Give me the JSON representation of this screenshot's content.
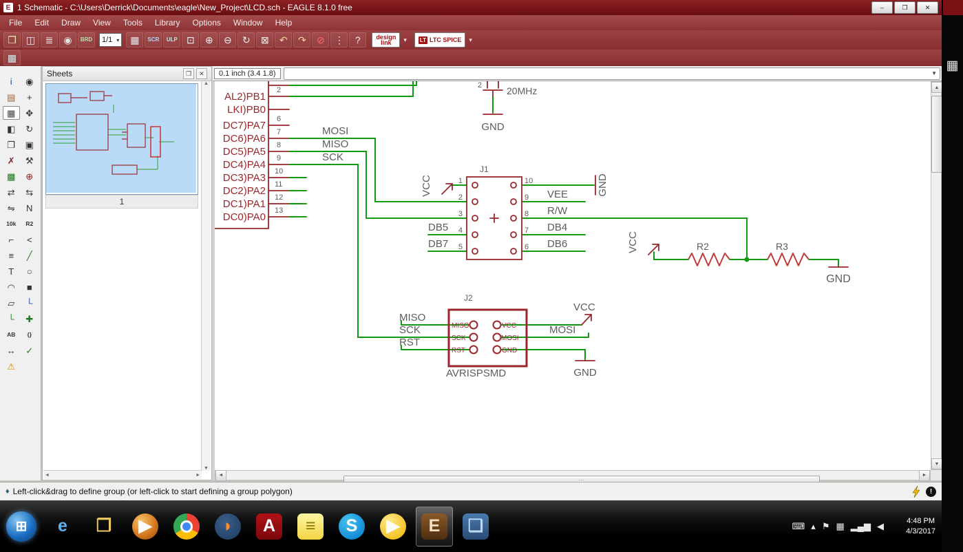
{
  "window": {
    "icon": "E",
    "title": "1 Schematic - C:\\Users\\Derrick\\Documents\\eagle\\New_Project\\LCD.sch - EAGLE 8.1.0 free",
    "minimize": "–",
    "maximize": "❐",
    "close": "✕"
  },
  "menubar": [
    {
      "n": "menu-file",
      "label": "File"
    },
    {
      "n": "menu-edit",
      "label": "Edit"
    },
    {
      "n": "menu-draw",
      "label": "Draw"
    },
    {
      "n": "menu-view",
      "label": "View"
    },
    {
      "n": "menu-tools",
      "label": "Tools"
    },
    {
      "n": "menu-library",
      "label": "Library"
    },
    {
      "n": "menu-options",
      "label": "Options"
    },
    {
      "n": "menu-window",
      "label": "Window"
    },
    {
      "n": "menu-help",
      "label": "Help"
    }
  ],
  "toolbar": {
    "icons1": [
      {
        "n": "open-button",
        "g": "❒",
        "c": "#f7e9b5"
      },
      {
        "n": "save-button",
        "g": "◫",
        "c": "#e8e8f7"
      },
      {
        "n": "print-button",
        "g": "≣",
        "c": "#f0f0f0"
      },
      {
        "n": "export-image-button",
        "g": "◉",
        "c": "#e2e2e2"
      },
      {
        "n": "switch-to-board-button",
        "g": "BRD",
        "c": "#a5e8a5"
      }
    ],
    "sheet_combo": "1/1",
    "caret": "▾",
    "icons2": [
      {
        "n": "grid-table-button",
        "g": "▦",
        "c": "#e8e8e8"
      },
      {
        "n": "run-script-button",
        "g": "SCR",
        "c": "#bcd4f5"
      },
      {
        "n": "run-ulp-button",
        "g": "ULP",
        "c": "#bfe8e0"
      },
      {
        "n": "zoom-fit-button",
        "g": "⊡",
        "c": "#f0f0f0"
      },
      {
        "n": "zoom-in-button",
        "g": "⊕",
        "c": "#f0f0f0"
      },
      {
        "n": "zoom-out-button",
        "g": "⊖",
        "c": "#f0f0f0"
      },
      {
        "n": "zoom-redraw-button",
        "g": "↻",
        "c": "#f0f0f0"
      },
      {
        "n": "zoom-select-button",
        "g": "⊠",
        "c": "#f0f0f0"
      },
      {
        "n": "undo-button",
        "g": "↶",
        "c": "#f7d9a0"
      },
      {
        "n": "redo-button",
        "g": "↷",
        "c": "#f7d9a0"
      },
      {
        "n": "stop-button",
        "g": "⊘",
        "c": "#ff6a6a"
      },
      {
        "n": "overflow-button",
        "g": "⋮",
        "c": "#f0f0f0"
      },
      {
        "n": "help-button",
        "g": "?",
        "c": "#f0f0f0"
      }
    ],
    "design_link": {
      "top": "design",
      "bottom": "link"
    },
    "ltc_logo": "LT",
    "ltc_label": "LTC SPICE",
    "grid_button": "▦"
  },
  "coordbar": {
    "coords": "0.1 inch (3.4 1.8)",
    "dropdown_icon": "▼"
  },
  "sheets": {
    "title": "Sheets",
    "dock_icon": "❐",
    "close_icon": "✕",
    "sheet_label": "1"
  },
  "tools": [
    {
      "n": "tool-info-icon",
      "g": "i",
      "c": "#20508e"
    },
    {
      "n": "tool-show-icon",
      "g": "◉",
      "c": "#333333"
    },
    {
      "n": "tool-display-icon",
      "g": "▤",
      "c": "#a06030"
    },
    {
      "n": "tool-mark-icon",
      "g": "+",
      "c": "#333333"
    },
    {
      "n": "tool-group-icon",
      "g": "▦",
      "c": "#444444",
      "sel": true
    },
    {
      "n": "tool-move-icon",
      "g": "✥",
      "c": "#333333"
    },
    {
      "n": "tool-mirror-icon",
      "g": "◧",
      "c": "#333333"
    },
    {
      "n": "tool-rotate-icon",
      "g": "↻",
      "c": "#333333"
    },
    {
      "n": "tool-copy-icon",
      "g": "❐",
      "c": "#333333"
    },
    {
      "n": "tool-paste-icon",
      "g": "▣",
      "c": "#333333"
    },
    {
      "n": "tool-delete-icon",
      "g": "✗",
      "c": "#8a1f1f"
    },
    {
      "n": "tool-fix-icon",
      "g": "⚒",
      "c": "#333333"
    },
    {
      "n": "tool-change-icon",
      "g": "▩",
      "c": "#1f7a1f"
    },
    {
      "n": "tool-add-icon",
      "g": "⊕",
      "c": "#8a1f1f"
    },
    {
      "n": "tool-pinswap-icon",
      "g": "⇄",
      "c": "#333333"
    },
    {
      "n": "tool-replace-icon",
      "g": "⇆",
      "c": "#333333"
    },
    {
      "n": "tool-gateswap-icon",
      "g": "⇋",
      "c": "#333333"
    },
    {
      "n": "tool-name-icon",
      "g": "N",
      "c": "#333333"
    },
    {
      "n": "tool-value-icon",
      "g": "10k",
      "c": "#333333"
    },
    {
      "n": "tool-smash-icon",
      "g": "R2",
      "c": "#333333"
    },
    {
      "n": "tool-miter-icon",
      "g": "⌐",
      "c": "#333333"
    },
    {
      "n": "tool-split-icon",
      "g": "<",
      "c": "#333333"
    },
    {
      "n": "tool-invoke-icon",
      "g": "≡",
      "c": "#333333"
    },
    {
      "n": "tool-wire-icon",
      "g": "╱",
      "c": "#1f7a1f"
    },
    {
      "n": "tool-text-icon",
      "g": "T",
      "c": "#333333"
    },
    {
      "n": "tool-circle-icon",
      "g": "○",
      "c": "#333333"
    },
    {
      "n": "tool-arc-icon",
      "g": "◠",
      "c": "#333333"
    },
    {
      "n": "tool-rect-icon",
      "g": "■",
      "c": "#333333"
    },
    {
      "n": "tool-polygon-icon",
      "g": "▱",
      "c": "#333333"
    },
    {
      "n": "tool-bus-icon",
      "g": "└",
      "c": "#2244aa"
    },
    {
      "n": "tool-net-icon",
      "g": "└",
      "c": "#1f7a1f"
    },
    {
      "n": "tool-junction-icon",
      "g": "✚",
      "c": "#1f7a1f"
    },
    {
      "n": "tool-label-icon",
      "g": "AB",
      "c": "#333333"
    },
    {
      "n": "tool-attribute-icon",
      "g": "{}",
      "c": "#333333"
    },
    {
      "n": "tool-dimension-icon",
      "g": "↔",
      "c": "#333333"
    },
    {
      "n": "tool-erc-icon",
      "g": "✓",
      "c": "#1f7a1f"
    },
    {
      "n": "tool-errors-icon",
      "g": "⚠",
      "c": "#d89000"
    }
  ],
  "schematic": {
    "colors": {
      "wire": "#129a12",
      "symbol": "#9b262b",
      "label": "#5c5c5c",
      "resistor": "#c23b3b"
    },
    "ic": {
      "pins": [
        "AL2)PB1",
        "LKI)PB0",
        "DC7)PA7",
        "DC6)PA6",
        "DC5)PA5",
        "DC4)PA4",
        "DC3)PA3",
        "DC2)PA2",
        "DC1)PA1",
        "DC0)PA0"
      ],
      "numbers": [
        "2",
        "6",
        "7",
        "8",
        "9",
        "10",
        "11",
        "12",
        "13"
      ]
    },
    "nets": {
      "mosi": "MOSI",
      "miso": "MISO",
      "sck": "SCK"
    },
    "crystal": {
      "pin": "2",
      "value": "20MHz",
      "gnd": "GND"
    },
    "j1": {
      "name": "J1",
      "left_numbers": [
        "1",
        "2",
        "3",
        "4",
        "5"
      ],
      "right_numbers": [
        "10",
        "9",
        "8",
        "7",
        "6"
      ],
      "vcc": "VCC",
      "gnd": "GND",
      "vee": "VEE",
      "rw": "R/W",
      "db4": "DB4",
      "db5": "DB5",
      "db6": "DB6",
      "db7": "DB7"
    },
    "divider": {
      "vcc": "VCC",
      "r2": "R2",
      "r3": "R3",
      "gnd": "GND"
    },
    "j2": {
      "name": "J2",
      "value": "AVRISPSMD",
      "inner": [
        "MISO",
        "VCC",
        "SCK",
        "MOSI",
        "RST",
        "GND"
      ],
      "left": [
        "MISO",
        "SCK",
        "RST"
      ],
      "vcc": "VCC",
      "mosi": "MOSI",
      "gnd": "GND"
    }
  },
  "scrollbar": {
    "up": "▲",
    "down": "▼",
    "left": "◄",
    "right": "►",
    "grip": "⋯"
  },
  "statusbar": {
    "bullet": "♦",
    "message": "Left-click&drag to define group (or left-click to start defining a group polygon)"
  },
  "taskbar": {
    "items": [
      {
        "n": "start-button",
        "g": "⊞",
        "bg": "radial-gradient(circle at 35% 30%, #86c7f2, #1b6ec2 55%, #0a3c74)",
        "round": true
      },
      {
        "n": "taskbar-ie-icon",
        "g": "e",
        "c": "#5fb2f2"
      },
      {
        "n": "taskbar-explorer-icon",
        "g": "❒",
        "c": "#ecc960"
      },
      {
        "n": "taskbar-wmp-icon",
        "g": "▶",
        "c": "#ffffff",
        "bg": "radial-gradient(circle at 35% 30%, #f8c36a, #d1731a 60%, #8a4a08)",
        "round": true
      },
      {
        "n": "taskbar-chrome-icon",
        "g": "",
        "bg": "conic-gradient(#ea4335 0 33%, #fbbc05 33% 66%, #34a853 66% 100%)",
        "round": true,
        "dot": "#4285f4"
      },
      {
        "n": "taskbar-firefox-icon",
        "g": "◗",
        "c": "#ff8a2a",
        "bg": "radial-gradient(circle at 40% 35%, #3b5f8a, #1d3a5f)",
        "round": true
      },
      {
        "n": "taskbar-adobe-icon",
        "g": "A",
        "c": "#ffffff",
        "bg": "linear-gradient(#b01116,#7a0a0d)"
      },
      {
        "n": "taskbar-notes-icon",
        "g": "≡",
        "c": "#8a7a10",
        "bg": "linear-gradient(#fdf6a2,#f3d443)"
      },
      {
        "n": "taskbar-skype-icon",
        "g": "S",
        "c": "#ffffff",
        "bg": "radial-gradient(circle at 35% 30%, #45c2f0, #0078ca)",
        "round": true
      },
      {
        "n": "taskbar-play-icon",
        "g": "▶",
        "c": "#ffffff",
        "bg": "radial-gradient(circle at 35% 30%, #ffe98a, #efb400)",
        "round": true
      },
      {
        "n": "taskbar-eagle-icon",
        "g": "E",
        "c": "#f2e0c0",
        "bg": "linear-gradient(#8a5a2a,#4e2e10)",
        "active": true
      },
      {
        "n": "taskbar-photos-icon",
        "g": "❏",
        "c": "#bcd9f2",
        "bg": "linear-gradient(#4a7ab0,#2a4a74)"
      }
    ],
    "tray": [
      {
        "n": "tray-keyboard-icon",
        "g": "⌨"
      },
      {
        "n": "tray-show-hidden-icon",
        "g": "▴"
      },
      {
        "n": "tray-flag-icon",
        "g": "⚑"
      },
      {
        "n": "tray-display-icon",
        "g": "▦"
      },
      {
        "n": "tray-network-icon",
        "g": "▂▄▆"
      },
      {
        "n": "tray-volume-icon",
        "g": "◀"
      }
    ],
    "clock": {
      "time": "4:48 PM",
      "date": "4/3/2017"
    }
  },
  "side_strip": {
    "grid_icon": "▦"
  }
}
